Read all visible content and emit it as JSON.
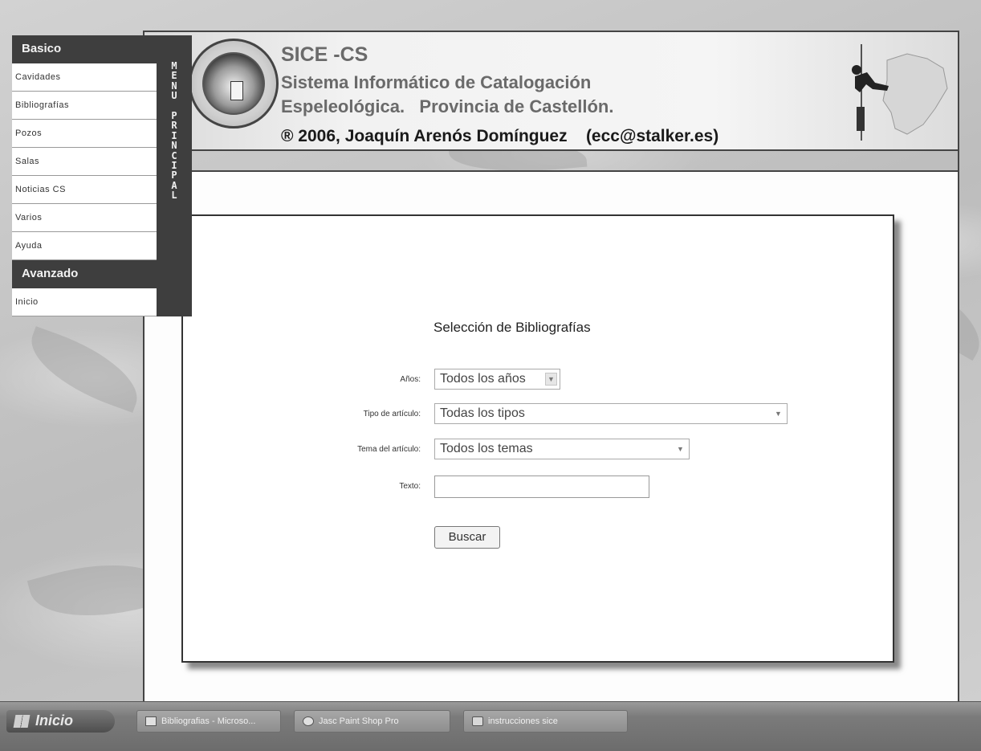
{
  "header": {
    "title": "SICE -CS",
    "subtitle_line1": "Sistema Informático de Catalogación",
    "subtitle_line2": "Espeleológica.   Provincia de Castellón.",
    "credit": "® 2006, Joaquín Arenós Domínguez    (ecc@stalker.es)"
  },
  "menu": {
    "basic_header": "Basico",
    "basic_items": [
      "Cavidades",
      "Bibliografías",
      "Pozos",
      "Salas",
      "Noticias CS",
      "Varios",
      "Ayuda"
    ],
    "advanced_header": "Avanzado",
    "advanced_items": [
      "Inicio"
    ],
    "vertical_label": [
      "M",
      "E",
      "N",
      "U",
      "",
      "P",
      "R",
      "I",
      "N",
      "C",
      "I",
      "P",
      "A",
      "L"
    ]
  },
  "form": {
    "title": "Selección de Bibliografías",
    "years_label": "Años:",
    "years_value": "Todos los años",
    "type_label": "Tipo de artículo:",
    "type_value": "Todas los tipos",
    "topic_label": "Tema del artículo:",
    "topic_value": "Todos los temas",
    "text_label": "Texto:",
    "text_value": "",
    "search_button": "Buscar"
  },
  "taskbar": {
    "start_label": "Inicio",
    "tasks": [
      "Bibliografias - Microso...",
      "Jasc Paint Shop Pro",
      "instrucciones sice"
    ]
  },
  "colors": {
    "menu_dark": "#3e3e3e",
    "frame_border": "#444444"
  }
}
